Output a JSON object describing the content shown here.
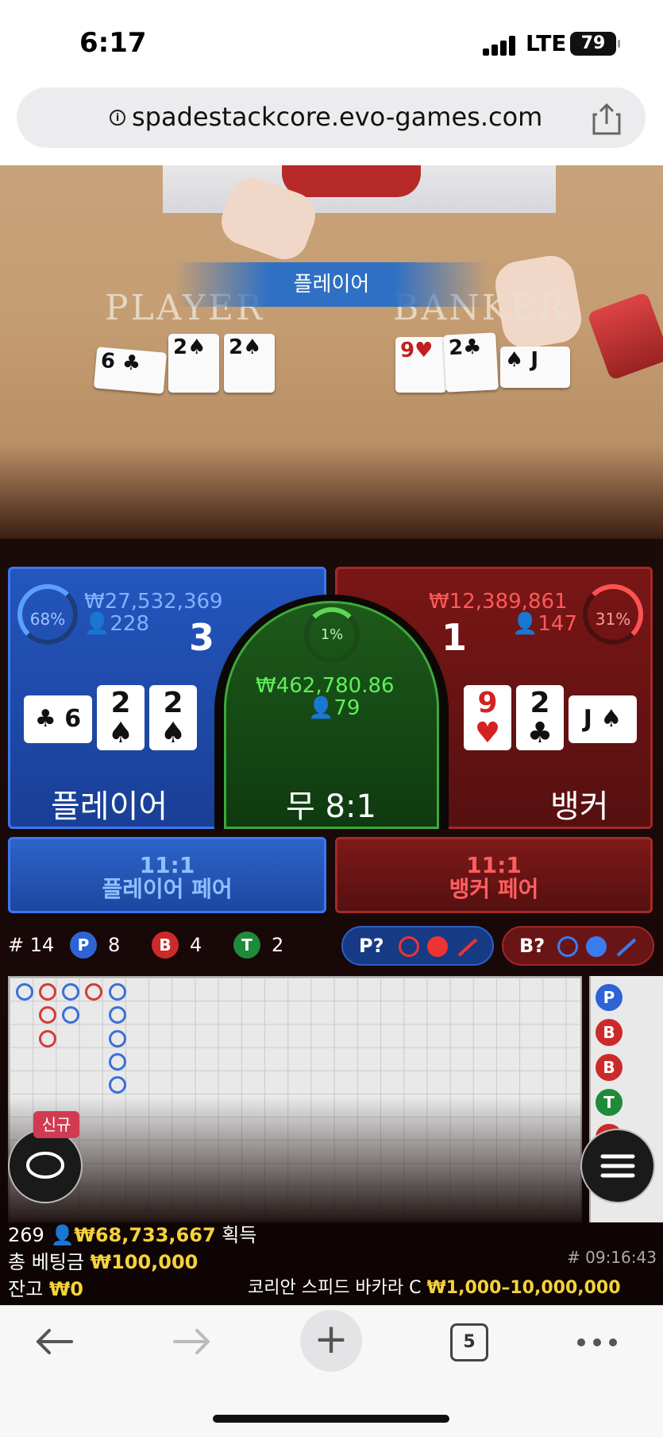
{
  "status_bar": {
    "time": "6:17",
    "network": "LTE",
    "battery": "79"
  },
  "browser": {
    "url": "spadestackcore.evo-games.com"
  },
  "table_view": {
    "banner": "플레이어",
    "felt_player": "PLAYER",
    "felt_banker": "BANKER",
    "player_cards": [
      {
        "rank": "6",
        "suit": "♣",
        "color": "black"
      },
      {
        "rank": "2",
        "suit": "♠",
        "color": "black"
      },
      {
        "rank": "2",
        "suit": "♠",
        "color": "black"
      }
    ],
    "banker_cards": [
      {
        "rank": "9",
        "suit": "♥",
        "color": "red"
      },
      {
        "rank": "2",
        "suit": "♣",
        "color": "black"
      },
      {
        "rank": "J",
        "suit": "♠",
        "color": "black"
      }
    ]
  },
  "bets": {
    "player": {
      "percent": "68%",
      "amount": "₩27,532,369",
      "count": "228",
      "score": "3",
      "label": "플레이어"
    },
    "tie": {
      "percent": "1%",
      "amount": "₩462,780.86",
      "count": "79",
      "label": "무 8:1"
    },
    "banker": {
      "percent": "31%",
      "amount": "₩12,389,861",
      "count": "147",
      "score": "1",
      "label": "뱅커"
    },
    "player_pair": {
      "odds": "11:1",
      "label": "플레이어 페어"
    },
    "banker_pair": {
      "odds": "11:1",
      "label": "뱅커 페어"
    }
  },
  "stats": {
    "round": "# 14",
    "p_letter": "P",
    "p_count": "8",
    "b_letter": "B",
    "b_count": "4",
    "t_letter": "T",
    "t_count": "2",
    "p_query": "P?",
    "b_query": "B?"
  },
  "beads": [
    "P",
    "B",
    "B",
    "T",
    "B"
  ],
  "chat": {
    "new_label": "신규"
  },
  "footer": {
    "players": "269",
    "winnings": "₩68,733,667",
    "winnings_label": "획득",
    "total_bet_label": "총 베팅금",
    "total_bet": "₩100,000",
    "balance_label": "잔고",
    "balance": "₩0",
    "game_time": "# 09:16:43",
    "table_name": "코리안 스피드 바카라 C",
    "limits": "₩1,000–10,000,000"
  },
  "nav": {
    "tabs_count": "5"
  },
  "colors": {
    "player_blue": "#2456bd",
    "banker_red": "#7a1616",
    "tie_green": "#1d5a1a",
    "gold": "#f5d23a"
  }
}
